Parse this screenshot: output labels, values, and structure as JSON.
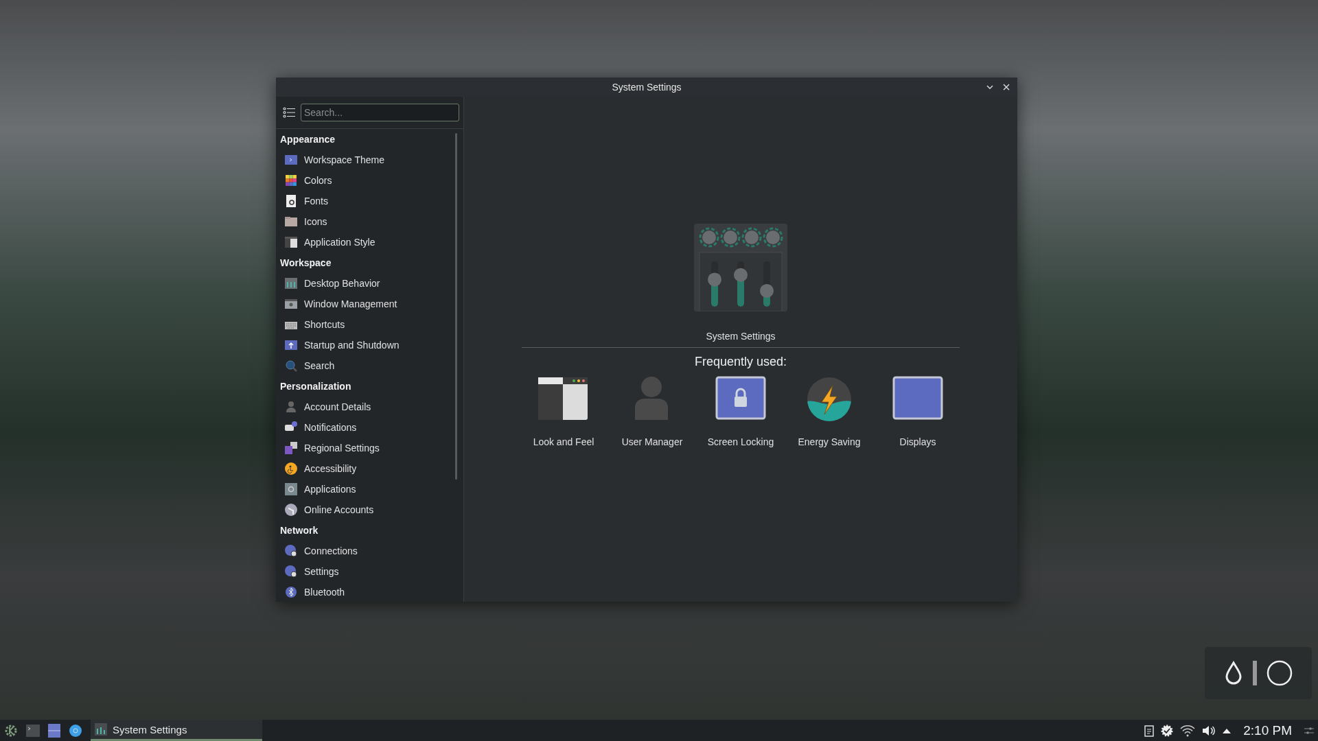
{
  "window": {
    "title": "System Settings"
  },
  "sidebar": {
    "search": {
      "placeholder": "Search..."
    },
    "groups": [
      {
        "heading": "Appearance",
        "items": [
          {
            "label": "Workspace Theme",
            "kind": "theme"
          },
          {
            "label": "Colors",
            "kind": "colors"
          },
          {
            "label": "Fonts",
            "kind": "fonts"
          },
          {
            "label": "Icons",
            "kind": "icons"
          },
          {
            "label": "Application Style",
            "kind": "appstyle"
          }
        ]
      },
      {
        "heading": "Workspace",
        "items": [
          {
            "label": "Desktop Behavior",
            "kind": "desktop"
          },
          {
            "label": "Window Management",
            "kind": "window"
          },
          {
            "label": "Shortcuts",
            "kind": "keyboard"
          },
          {
            "label": "Startup and Shutdown",
            "kind": "startup"
          },
          {
            "label": "Search",
            "kind": "search"
          }
        ]
      },
      {
        "heading": "Personalization",
        "items": [
          {
            "label": "Account Details",
            "kind": "person"
          },
          {
            "label": "Notifications",
            "kind": "bubble"
          },
          {
            "label": "Regional Settings",
            "kind": "regional"
          },
          {
            "label": "Accessibility",
            "kind": "access"
          },
          {
            "label": "Applications",
            "kind": "apps"
          },
          {
            "label": "Online Accounts",
            "kind": "globe"
          }
        ]
      },
      {
        "heading": "Network",
        "items": [
          {
            "label": "Connections",
            "kind": "netgear"
          },
          {
            "label": "Settings",
            "kind": "netgear"
          },
          {
            "label": "Bluetooth",
            "kind": "bluetooth"
          }
        ]
      }
    ]
  },
  "main": {
    "title": "System Settings",
    "frequent_heading": "Frequently used:",
    "frequent": [
      {
        "label": "Look and Feel",
        "kind": "lookfeel"
      },
      {
        "label": "User Manager",
        "kind": "user"
      },
      {
        "label": "Screen Locking",
        "kind": "lock"
      },
      {
        "label": "Energy Saving",
        "kind": "energy"
      },
      {
        "label": "Displays",
        "kind": "display"
      }
    ]
  },
  "taskbar": {
    "tasks": [
      {
        "label": "System Settings",
        "selected": true
      }
    ],
    "clock": "2:10 PM"
  }
}
